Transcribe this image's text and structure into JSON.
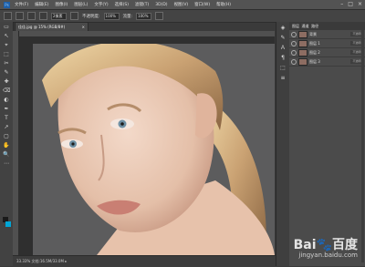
{
  "menu": {
    "logo": "Ps",
    "items": [
      "文件(F)",
      "编辑(E)",
      "图像(I)",
      "图层(L)",
      "文字(Y)",
      "选择(S)",
      "滤镜(T)",
      "3D(D)",
      "视图(V)",
      "窗口(W)",
      "帮助(H)"
    ],
    "window_controls": [
      "–",
      "□",
      "×"
    ]
  },
  "options": {
    "size_value": "2像素",
    "opacity_label": "不透明度:",
    "opacity_value": "100%",
    "flow_label": "流量:",
    "flow_value": "100%"
  },
  "document": {
    "tab_title": "佳佳.jpg @ 15% (RGB/8#)",
    "close": "×"
  },
  "tools": [
    "▭",
    "↖",
    "⌖",
    "⬚",
    "✂",
    "✎",
    "✚",
    "⌫",
    "◐",
    "✒",
    "T",
    "↗",
    "▢",
    "✋",
    "🔍",
    "⋯"
  ],
  "mid_tools": [
    "◈",
    "✎",
    "Ａ",
    "¶",
    "⬚",
    "≡"
  ],
  "layers": {
    "tabs": [
      "图层",
      "通道",
      "路径"
    ],
    "items": [
      {
        "name": "背景",
        "opacity": "不透明"
      },
      {
        "name": "图层 1",
        "opacity": "不透明"
      },
      {
        "name": "图层 2",
        "opacity": "不透明"
      },
      {
        "name": "图层 3",
        "opacity": "不透明"
      }
    ]
  },
  "status": "33.33%   文档:16.5M/33.0M   ▸",
  "watermark": {
    "logo": "Bai🐾百度",
    "url": "jingyan.baidu.com"
  },
  "colors": {
    "foreground": "#1a1a1a",
    "background": "#00a6d6",
    "canvas_bg": "#5c5c5d"
  }
}
